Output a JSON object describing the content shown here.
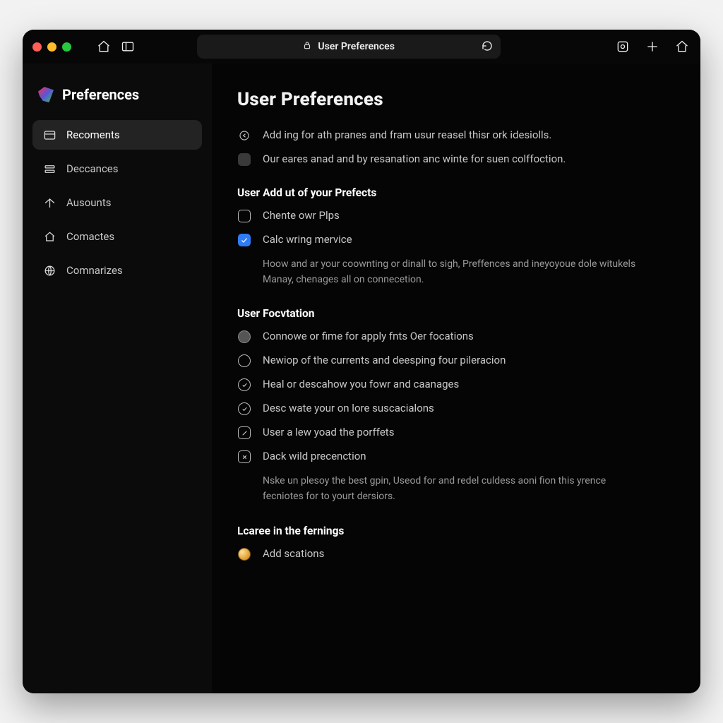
{
  "titlebar": {
    "address_title": "User Preferences"
  },
  "brand": {
    "title": "Preferences"
  },
  "sidebar": {
    "items": [
      {
        "label": "Recoments"
      },
      {
        "label": "Deccances"
      },
      {
        "label": "Ausounts"
      },
      {
        "label": "Comactes"
      },
      {
        "label": "Comnarizes"
      }
    ]
  },
  "main": {
    "page_title": "User Preferences",
    "intro_rows": [
      {
        "text": "Add ing for ath pranes and fram usur reasel thisr ork idesiolls."
      },
      {
        "text": "Our eares anad and by resanation anc winte for suen colffoction."
      }
    ],
    "section1": {
      "title": "User Add ut of your Prefects",
      "options": [
        {
          "label": "Chente owr Plps"
        },
        {
          "label": "Calc wring mervice"
        }
      ],
      "description": "Hoow and ar your coownting or dinall to sigh, Preffences and ineyoyoue dole witukels Manay, chenages all on connecetion."
    },
    "section2": {
      "title": "User Focvtation",
      "options": [
        {
          "label": "Connowe or fime for apply fnts Oer focations"
        },
        {
          "label": "Newiop of the currents and deesping four pileracion"
        },
        {
          "label": "Heal or descahow you fowr and caanages"
        },
        {
          "label": "Desc wate your on lore suscacialons"
        },
        {
          "label": "User a lew yoad the porffets"
        },
        {
          "label": "Dack wild precenction"
        }
      ],
      "description": "Nske un plesoy the best gpin, Useod for and redel culdess aoni fion this yrence fecniotes for to yourt dersiors."
    },
    "section3": {
      "title": "Lcaree in the fernings",
      "options": [
        {
          "label": "Add scations"
        }
      ]
    }
  }
}
